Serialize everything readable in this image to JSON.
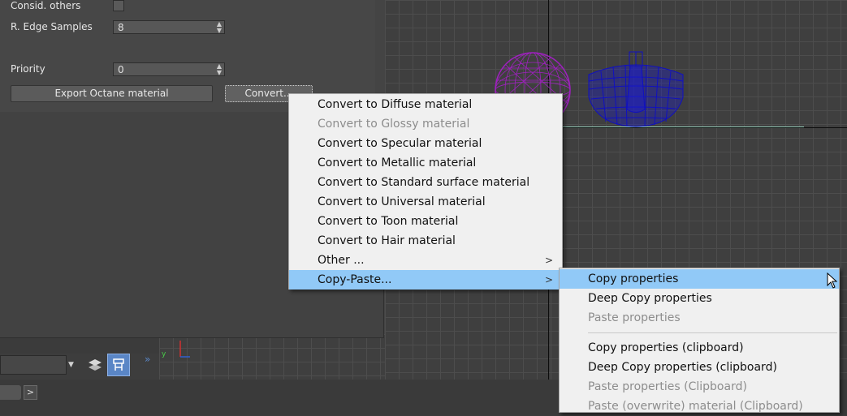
{
  "panel": {
    "consid_others_label": "Consid. others",
    "edge_samples_label": "R. Edge Samples",
    "edge_samples_value": "8",
    "priority_label": "Priority",
    "priority_value": "0",
    "export_button": "Export Octane material",
    "convert_button": "Convert..."
  },
  "convert_menu": {
    "items": [
      {
        "label": "Convert to Diffuse material",
        "enabled": true
      },
      {
        "label": "Convert to Glossy material",
        "enabled": false
      },
      {
        "label": "Convert to Specular material",
        "enabled": true
      },
      {
        "label": "Convert to Metallic material",
        "enabled": true
      },
      {
        "label": "Convert to Standard surface material",
        "enabled": true
      },
      {
        "label": "Convert to Universal material",
        "enabled": true
      },
      {
        "label": "Convert to Toon material",
        "enabled": true
      },
      {
        "label": "Convert to Hair material",
        "enabled": true
      },
      {
        "label": "Other ...",
        "enabled": true,
        "submenu": true
      },
      {
        "label": "Copy-Paste...",
        "enabled": true,
        "submenu": true,
        "highlighted": true
      }
    ]
  },
  "copy_paste_menu": {
    "items": [
      {
        "label": "Copy properties",
        "enabled": true,
        "highlighted": true
      },
      {
        "label": "Deep Copy properties",
        "enabled": true
      },
      {
        "label": "Paste properties",
        "enabled": false
      },
      {
        "label": "Copy properties (clipboard)",
        "enabled": true
      },
      {
        "label": "Deep Copy properties (clipboard)",
        "enabled": true
      },
      {
        "label": "Paste properties (Clipboard)",
        "enabled": false
      },
      {
        "label": "Paste (overwrite) material (Clipboard)",
        "enabled": false
      }
    ]
  },
  "bottom": {
    "scroll_right": ">",
    "expand_chevron": "»",
    "axis_label": "y"
  },
  "colors": {
    "menu_highlight": "#91c9f7",
    "sphere": "#a020c0",
    "teapot": "#1010c0",
    "active_tool": "#5a86c6"
  }
}
